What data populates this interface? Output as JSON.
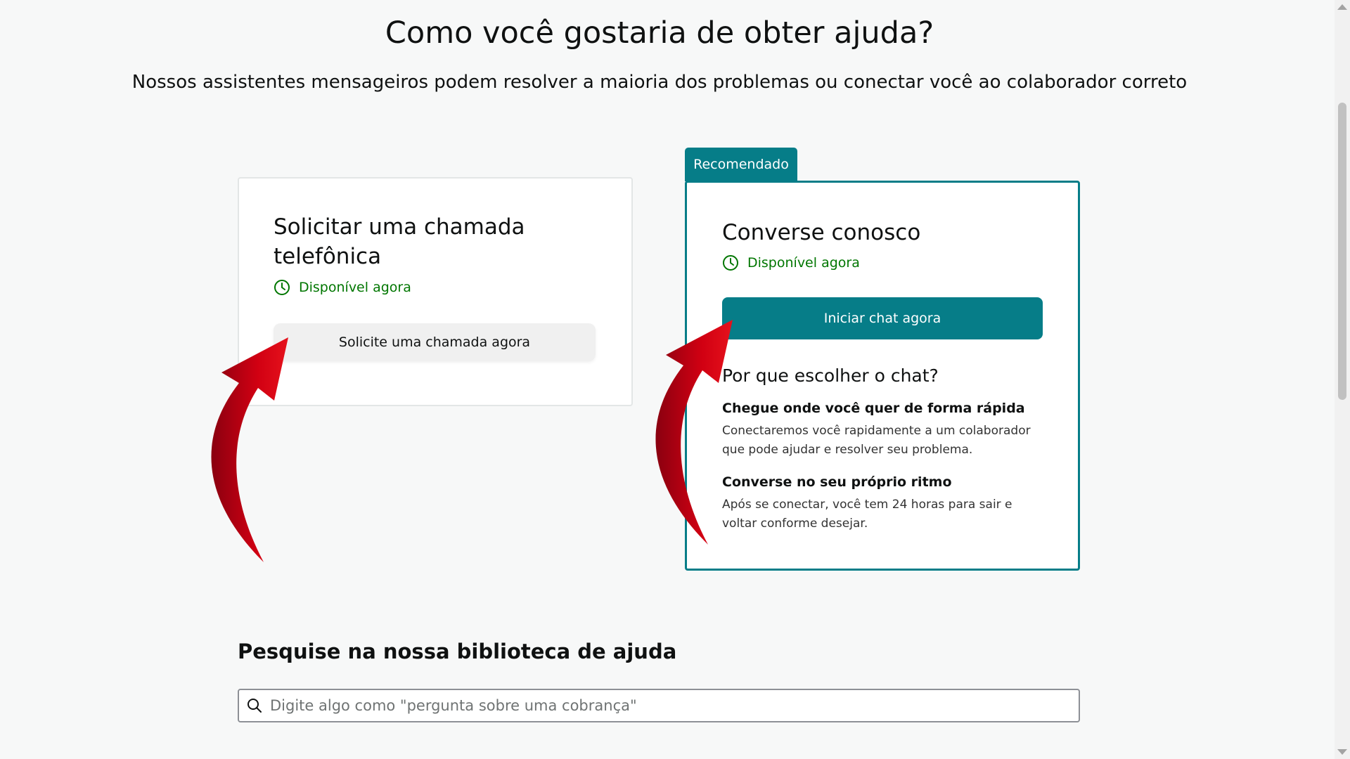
{
  "header": {
    "title": "Como você gostaria de obter ajuda?",
    "subtitle": "Nossos assistentes mensageiros podem resolver a maioria dos problemas ou conectar você ao colaborador correto"
  },
  "phone_card": {
    "title": "Solicitar uma chamada telefônica",
    "availability": "Disponível agora",
    "button_label": "Solicite uma chamada agora",
    "icon": "clock-icon"
  },
  "chat_card": {
    "badge": "Recomendado",
    "title": "Converse conosco",
    "availability": "Disponível agora",
    "button_label": "Iniciar chat agora",
    "why_title": "Por que escolher o chat?",
    "reasons": [
      {
        "heading": "Chegue onde você quer de forma rápida",
        "text": "Conectaremos você rapidamente a um colaborador que pode ajudar e resolver seu problema."
      },
      {
        "heading": "Converse no seu próprio ritmo",
        "text": "Após se conectar, você tem 24 horas para sair e voltar conforme desejar."
      }
    ],
    "icon": "clock-icon"
  },
  "help_search": {
    "title": "Pesquise na nossa biblioteca de ajuda",
    "placeholder": "Digite algo como \"pergunta sobre uma cobrança\"",
    "value": "",
    "icon": "search-icon"
  },
  "colors": {
    "accent": "#067d88",
    "available": "#007600",
    "annotation_arrow": "#c8000f"
  }
}
